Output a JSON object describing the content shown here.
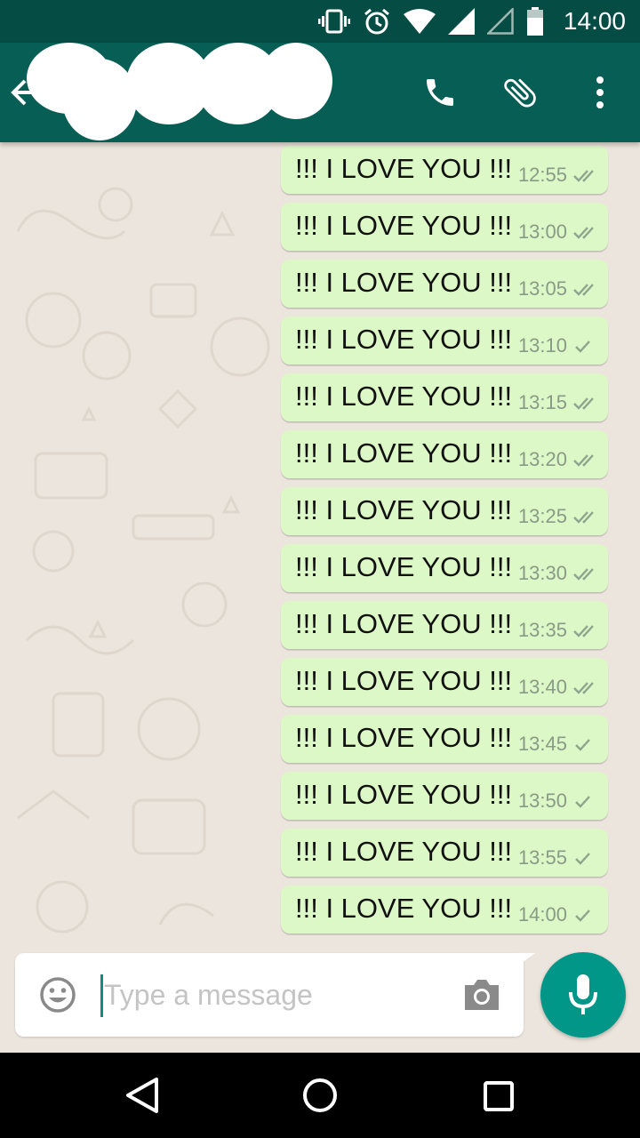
{
  "status_bar": {
    "time": "14:00",
    "icons": [
      "vibrate-icon",
      "alarm-icon",
      "wifi-icon",
      "signal-icon",
      "signal-empty-icon",
      "battery-icon"
    ]
  },
  "app_bar": {
    "contact_name": "",
    "actions": [
      "phone-icon",
      "attach-icon",
      "more-icon"
    ]
  },
  "messages": [
    {
      "text": "!!! I LOVE YOU !!!",
      "time": "12:55",
      "ticks": 2
    },
    {
      "text": "!!! I LOVE YOU !!!",
      "time": "13:00",
      "ticks": 2
    },
    {
      "text": "!!! I LOVE YOU !!!",
      "time": "13:05",
      "ticks": 2
    },
    {
      "text": "!!! I LOVE YOU !!!",
      "time": "13:10",
      "ticks": 1
    },
    {
      "text": "!!! I LOVE YOU !!!",
      "time": "13:15",
      "ticks": 2
    },
    {
      "text": "!!! I LOVE YOU !!!",
      "time": "13:20",
      "ticks": 2
    },
    {
      "text": "!!! I LOVE YOU !!!",
      "time": "13:25",
      "ticks": 2
    },
    {
      "text": "!!! I LOVE YOU !!!",
      "time": "13:30",
      "ticks": 2
    },
    {
      "text": "!!! I LOVE YOU !!!",
      "time": "13:35",
      "ticks": 2
    },
    {
      "text": "!!! I LOVE YOU !!!",
      "time": "13:40",
      "ticks": 2
    },
    {
      "text": "!!! I LOVE YOU !!!",
      "time": "13:45",
      "ticks": 1
    },
    {
      "text": "!!! I LOVE YOU !!!",
      "time": "13:50",
      "ticks": 1
    },
    {
      "text": "!!! I LOVE YOU !!!",
      "time": "13:55",
      "ticks": 1
    },
    {
      "text": "!!! I LOVE YOU !!!",
      "time": "14:00",
      "ticks": 1
    }
  ],
  "composer": {
    "placeholder": "Type a message",
    "value": ""
  },
  "colors": {
    "status_bar": "#054D44",
    "app_bar": "#075E54",
    "bubble_out": "#DCF8C6",
    "chat_bg": "#ECE5DD",
    "fab": "#009688"
  }
}
